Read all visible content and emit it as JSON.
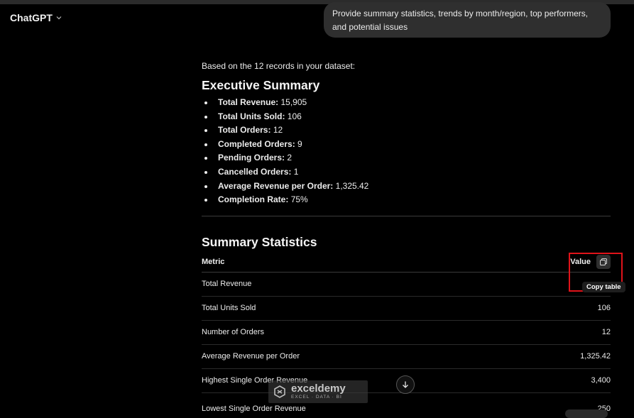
{
  "app": {
    "title": "ChatGPT"
  },
  "user_message": "Provide summary statistics, trends by month/region, top performers, and potential issues",
  "response": {
    "intro": "Based on the 12 records in your dataset:",
    "exec_title": "Executive Summary",
    "exec_items": [
      {
        "label": "Total Revenue:",
        "value": "15,905"
      },
      {
        "label": "Total Units Sold:",
        "value": "106"
      },
      {
        "label": "Total Orders:",
        "value": "12"
      },
      {
        "label": "Completed Orders:",
        "value": "9"
      },
      {
        "label": "Pending Orders:",
        "value": "2"
      },
      {
        "label": "Cancelled Orders:",
        "value": "1"
      },
      {
        "label": "Average Revenue per Order:",
        "value": "1,325.42"
      },
      {
        "label": "Completion Rate:",
        "value": "75%"
      }
    ],
    "stats_title": "Summary Statistics",
    "table": {
      "headers": [
        "Metric",
        "Value"
      ],
      "rows": [
        [
          "Total Revenue",
          ""
        ],
        [
          "Total Units Sold",
          "106"
        ],
        [
          "Number of Orders",
          "12"
        ],
        [
          "Average Revenue per Order",
          "1,325.42"
        ],
        [
          "Highest Single Order Revenue",
          "3,400"
        ]
      ],
      "partial_row": [
        "Lowest Single Order Revenue",
        "250"
      ]
    },
    "copy_tooltip": "Copy table"
  },
  "watermark": {
    "name": "exceldemy",
    "tagline": "EXCEL · DATA · BI"
  },
  "icons": {
    "brand_chevron": "chevron-down-icon",
    "copy": "copy-icon",
    "scroll_down": "arrow-down-icon",
    "watermark_logo": "exceldemy-logo-icon"
  },
  "colors": {
    "background": "#000000",
    "bubble": "#2f2f2f",
    "highlight": "#e0131a",
    "divider": "#3a3a3a"
  }
}
